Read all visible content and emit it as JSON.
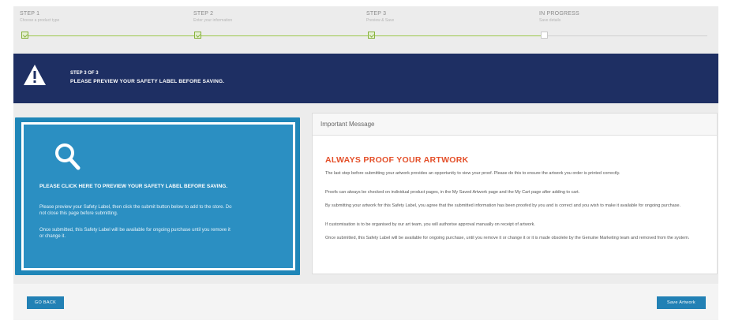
{
  "steps": [
    {
      "label": "STEP 1",
      "sub": "Choose a product type"
    },
    {
      "label": "STEP 2",
      "sub": "Enter your information"
    },
    {
      "label": "STEP 3",
      "sub": "Preview & Save"
    },
    {
      "label": "IN PROGRESS",
      "sub": "Save details"
    }
  ],
  "banner": {
    "line1": "STEP 3 OF 3",
    "line2": "PLEASE PREVIEW YOUR SAFETY LABEL BEFORE SAVING.",
    "icon": "warning-icon"
  },
  "preview": {
    "icon": "search-icon",
    "heading": "PLEASE CLICK HERE TO PREVIEW YOUR SAFETY LABEL BEFORE SAVING.",
    "para1": "Please preview your Safety Label, then click the submit button below to add to the store. Do not close this page before submitting.",
    "para2": "Once submitted, this Safety Label will be available for ongoing purchase until you remove it or change it."
  },
  "message": {
    "header": "Important Message",
    "title": "ALWAYS PROOF YOUR ARTWORK",
    "paragraphs": [
      "The last step before submitting your artwork provides an opportunity to view your proof. Please do this to ensure the artwork you order is printed correctly.",
      "Proofs can always be checked on individual product pages, in the My Saved Artwork page and the My Cart page after adding to cart.",
      "By submitting your artwork for this Safety Label, you agree that the submitted information has been proofed by you and is correct and you wish to make it available for ongoing purchase.",
      "If customisation is to be organised by our art team, you will authorise approval manually on receipt of artwork.",
      "Once submitted, this Safety Label will be available for ongoing purchase, until you remove it or change it or it is made obsolete by the Genuine Marketing team and removed from the system."
    ]
  },
  "footer": {
    "back_label": "GO BACK",
    "save_label": "Save Artwork"
  },
  "colors": {
    "banner": "#1e2f63",
    "preview": "#2b8fc2",
    "accent": "#e4502a",
    "progress": "#9cc74a",
    "button": "#2281b5"
  }
}
